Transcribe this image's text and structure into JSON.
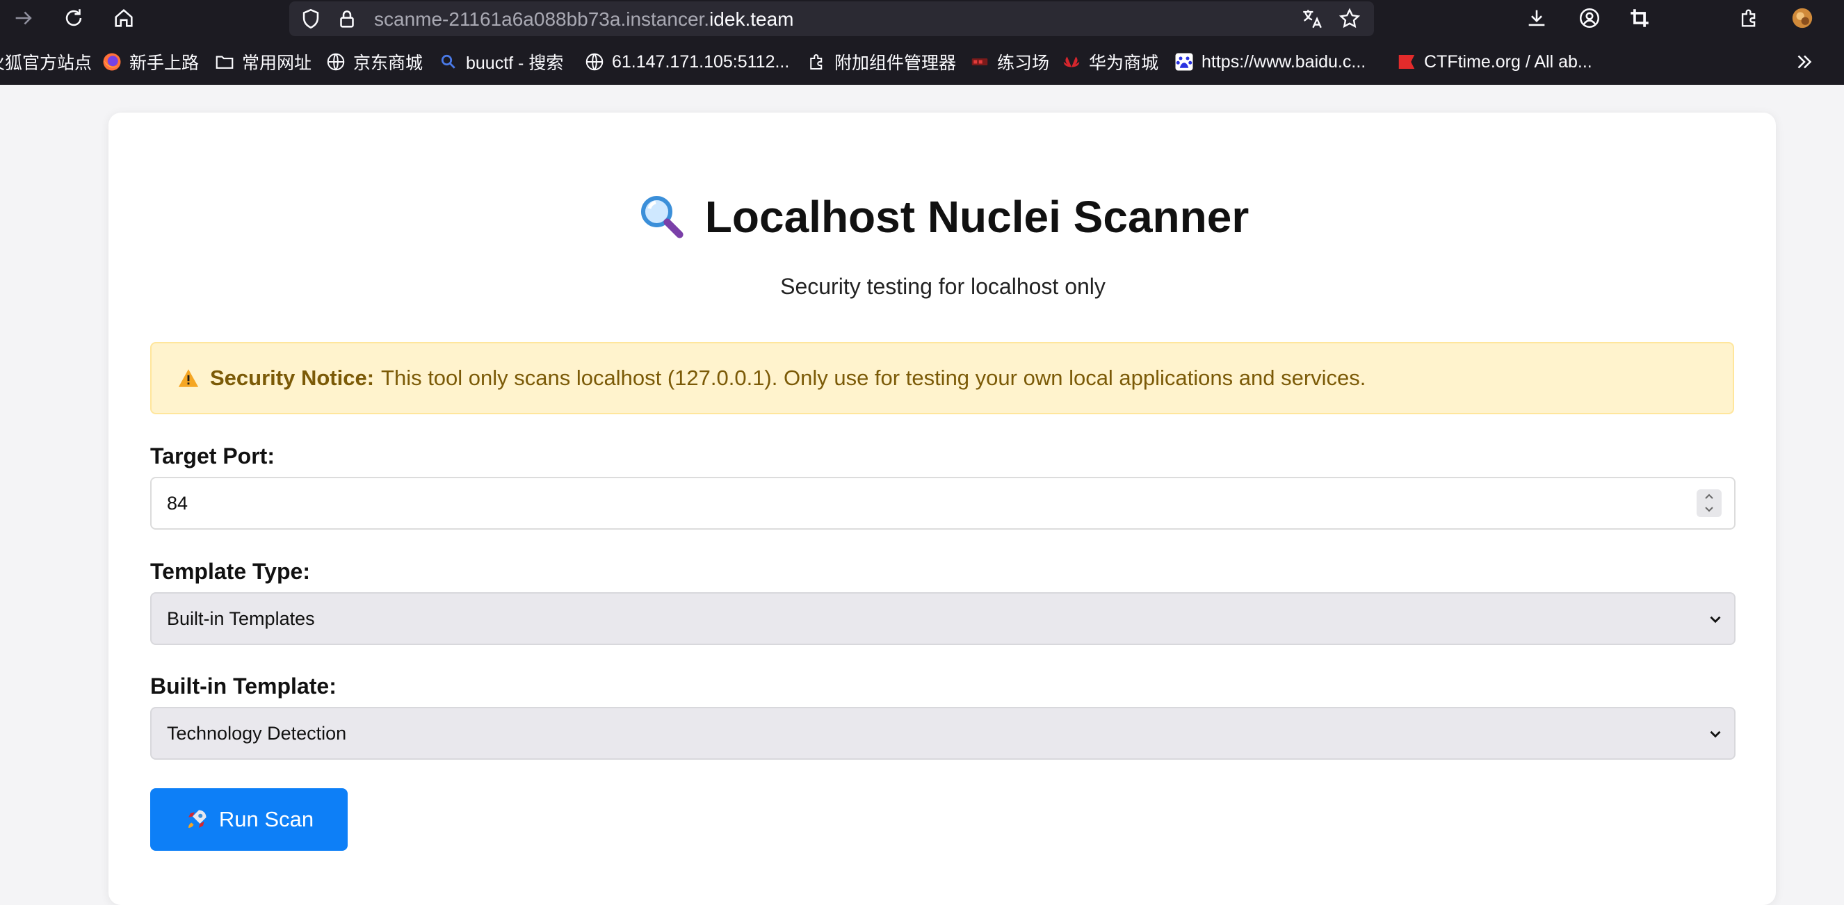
{
  "browser": {
    "url_dim": "scanme-21161a6a088bb73a.instancer.",
    "url_domain": "idek.team",
    "bookmarks": [
      {
        "label": "火狐官方站点",
        "icon": "firefox-icon"
      },
      {
        "label": "新手上路",
        "icon": "firefox-icon"
      },
      {
        "label": "常用网址",
        "icon": "folder-icon"
      },
      {
        "label": "京东商城",
        "icon": "globe-icon"
      },
      {
        "label": "buuctf - 搜索",
        "icon": "search-icon"
      },
      {
        "label": "61.147.171.105:5112...",
        "icon": "globe-icon"
      },
      {
        "label": "附加组件管理器",
        "icon": "puzzle-icon"
      },
      {
        "label": "练习场",
        "icon": "site-icon"
      },
      {
        "label": "华为商城",
        "icon": "huawei-icon"
      },
      {
        "label": "https://www.baidu.c...",
        "icon": "baidu-icon"
      },
      {
        "label": "CTFtime.org / All ab...",
        "icon": "ctftime-icon"
      }
    ]
  },
  "page": {
    "title": "Localhost Nuclei Scanner",
    "subtitle": "Security testing for localhost only",
    "notice_bold": "Security Notice:",
    "notice_text": "This tool only scans localhost (127.0.0.1). Only use for testing your own local applications and services.",
    "port_label": "Target Port:",
    "port_value": "84",
    "template_type_label": "Template Type:",
    "template_type_value": "Built-in Templates",
    "builtin_label": "Built-in Template:",
    "builtin_value": "Technology Detection",
    "run_label": "Run Scan"
  },
  "colors": {
    "accent": "#0d7ff7",
    "notice_bg": "#fff3cd",
    "notice_text": "#7b5a07",
    "chrome_bg": "#1c1b22"
  }
}
